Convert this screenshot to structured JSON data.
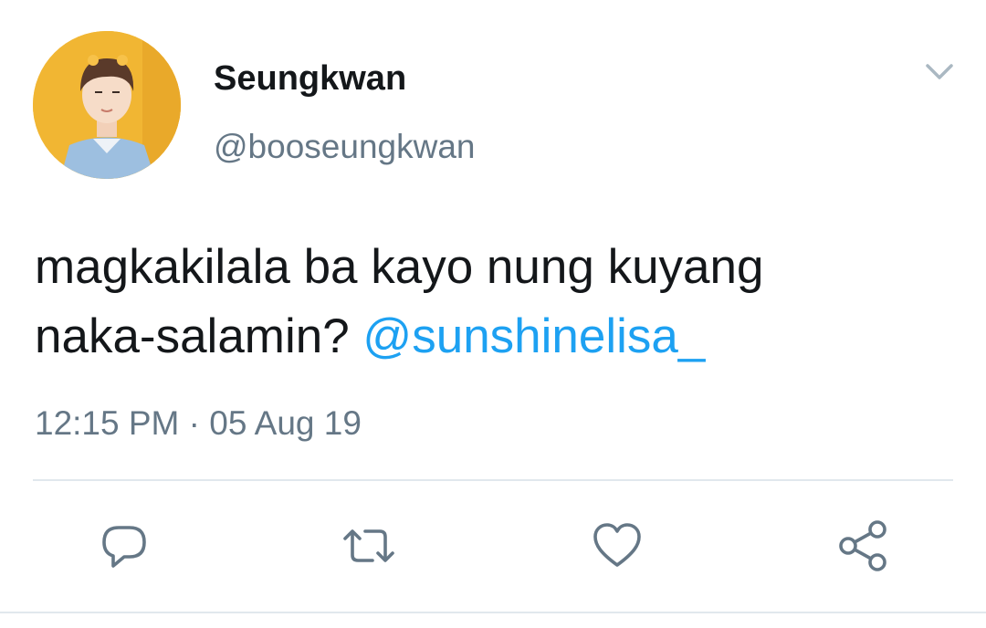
{
  "tweet": {
    "author": {
      "display_name": "Seungkwan",
      "handle": "@booseungkwan"
    },
    "text_line1": "magkakilala ba kayo nung kuyang",
    "text_line2": "naka-salamin?",
    "mention": "@sunshinelisa_",
    "timestamp": "12:15 PM · 05 Aug 19"
  },
  "colors": {
    "text": "#14171a",
    "secondary": "#657786",
    "link": "#1da1f2",
    "divider": "#e1e8ed",
    "avatar_bg": "#f1b633"
  },
  "icons": {
    "menu": "chevron-down-icon",
    "reply": "reply-icon",
    "retweet": "retweet-icon",
    "like": "heart-icon",
    "share": "share-icon"
  }
}
